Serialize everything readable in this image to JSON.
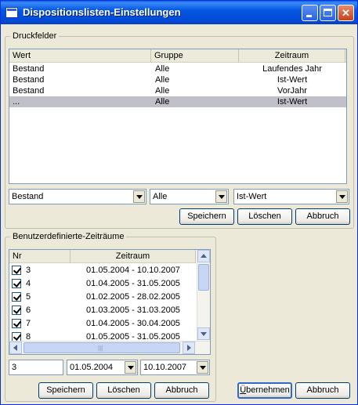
{
  "window": {
    "title": "Dispositionslisten-Einstellungen"
  },
  "druckfelder": {
    "group_label": "Druckfelder",
    "columns": [
      "Wert",
      "Gruppe",
      "Zeitraum"
    ],
    "rows": [
      {
        "wert": "Bestand",
        "gruppe": "Alle",
        "zeitraum": "Laufendes Jahr"
      },
      {
        "wert": "Bestand",
        "gruppe": "Alle",
        "zeitraum": "Ist-Wert"
      },
      {
        "wert": "Bestand",
        "gruppe": "Alle",
        "zeitraum": "VorJahr"
      },
      {
        "wert": "...",
        "gruppe": "Alle",
        "zeitraum": "Ist-Wert"
      }
    ],
    "combo_wert": "Bestand",
    "combo_gruppe": "Alle",
    "combo_zeitraum": "Ist-Wert",
    "btn_save": "Speichern",
    "btn_delete": "Löschen",
    "btn_cancel": "Abbruch"
  },
  "benutzer": {
    "group_label": "Benutzerdefinierte-Zeiträume",
    "columns": [
      "Nr",
      "Zeitraum"
    ],
    "rows": [
      {
        "nr": "3",
        "zeitraum": "01.05.2004 - 10.10.2007"
      },
      {
        "nr": "4",
        "zeitraum": "01.04.2005 - 31.05.2005"
      },
      {
        "nr": "5",
        "zeitraum": "01.02.2005 - 28.02.2005"
      },
      {
        "nr": "6",
        "zeitraum": "01.03.2005 - 31.03.2005"
      },
      {
        "nr": "7",
        "zeitraum": "01.04.2005 - 30.04.2005"
      },
      {
        "nr": "8",
        "zeitraum": "01.05.2005 - 31.05.2005"
      }
    ],
    "nr_value": "3",
    "from_date": "01.05.2004",
    "to_date": "10.10.2007",
    "btn_save": "Speichern",
    "btn_delete": "Löschen",
    "btn_cancel": "Abbruch"
  },
  "footer": {
    "ok_label_u": "Ü",
    "ok_label_rest": "bernehmen",
    "cancel_label": "Abbruch"
  }
}
